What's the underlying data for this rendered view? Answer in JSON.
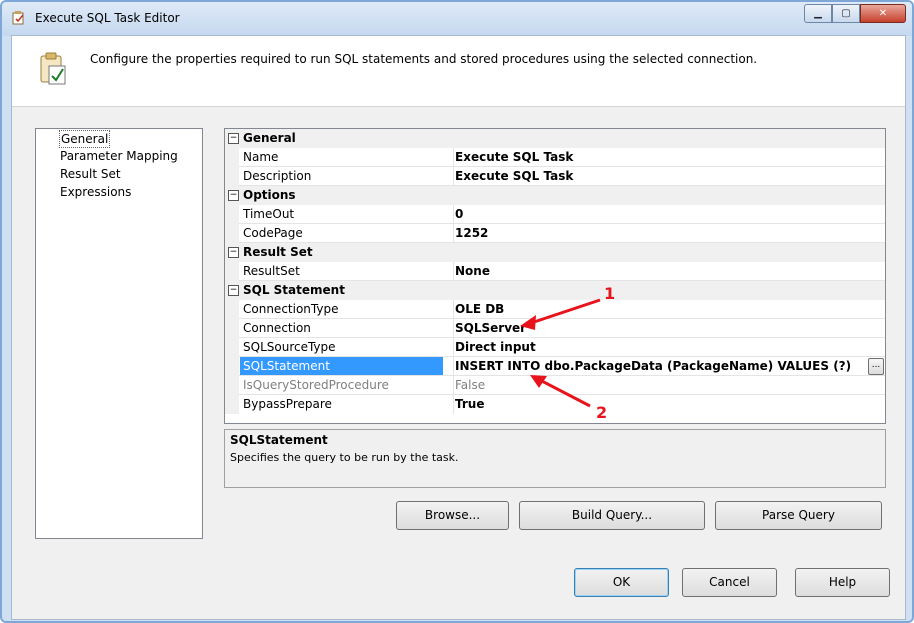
{
  "window": {
    "title": "Execute SQL Task Editor"
  },
  "header": {
    "text": "Configure the properties required to run SQL statements and stored procedures using the selected connection."
  },
  "nav": {
    "items": [
      {
        "label": "General"
      },
      {
        "label": "Parameter Mapping"
      },
      {
        "label": "Result Set"
      },
      {
        "label": "Expressions"
      }
    ]
  },
  "grid": {
    "categories": [
      {
        "label": "General",
        "props": [
          {
            "name": "Name",
            "value": "Execute SQL Task"
          },
          {
            "name": "Description",
            "value": "Execute SQL Task"
          }
        ]
      },
      {
        "label": "Options",
        "props": [
          {
            "name": "TimeOut",
            "value": "0"
          },
          {
            "name": "CodePage",
            "value": "1252"
          }
        ]
      },
      {
        "label": "Result Set",
        "props": [
          {
            "name": "ResultSet",
            "value": "None"
          }
        ]
      },
      {
        "label": "SQL Statement",
        "props": [
          {
            "name": "ConnectionType",
            "value": "OLE DB"
          },
          {
            "name": "Connection",
            "value": "SQLServer"
          },
          {
            "name": "SQLSourceType",
            "value": "Direct input"
          },
          {
            "name": "SQLStatement",
            "value": "INSERT INTO dbo.PackageData (PackageName) VALUES (?)"
          },
          {
            "name": "IsQueryStoredProcedure",
            "value": "False"
          },
          {
            "name": "BypassPrepare",
            "value": "True"
          }
        ]
      }
    ],
    "ellipsis_label": "..."
  },
  "description": {
    "title": "SQLStatement",
    "text": "Specifies the query to be run by the task."
  },
  "buttons": {
    "browse": "Browse...",
    "build_query": "Build Query...",
    "parse_query": "Parse Query",
    "ok": "OK",
    "cancel": "Cancel",
    "help": "Help"
  },
  "annotations": {
    "one": "1",
    "two": "2",
    "color": "#e8141b"
  }
}
